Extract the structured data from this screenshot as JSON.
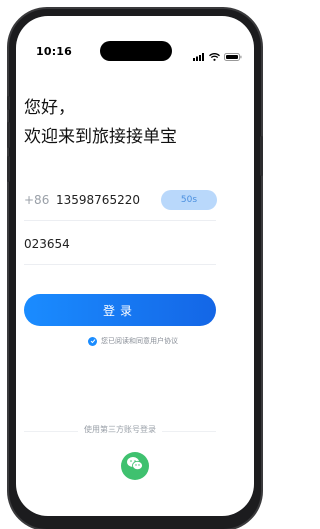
{
  "status_bar": {
    "time": "10:16",
    "icons": [
      "signal-icon",
      "wifi-icon",
      "battery-icon"
    ]
  },
  "greeting": {
    "line1": "您好，",
    "line2": "欢迎来到旅接接单宝"
  },
  "phone_field": {
    "prefix": "+86",
    "value": "13598765220",
    "code_button_label": "50s"
  },
  "code_field": {
    "value": "023654"
  },
  "login_button": {
    "label": "登录"
  },
  "agreement": {
    "checked": true,
    "text": "您已阅读和同意用户协议"
  },
  "third_party": {
    "label": "使用第三方账号登录",
    "providers": [
      "wechat-icon"
    ]
  },
  "colors": {
    "accent": "#1a8cff",
    "code_button_bg": "#b9d8fb",
    "wechat": "#3fc16f"
  }
}
